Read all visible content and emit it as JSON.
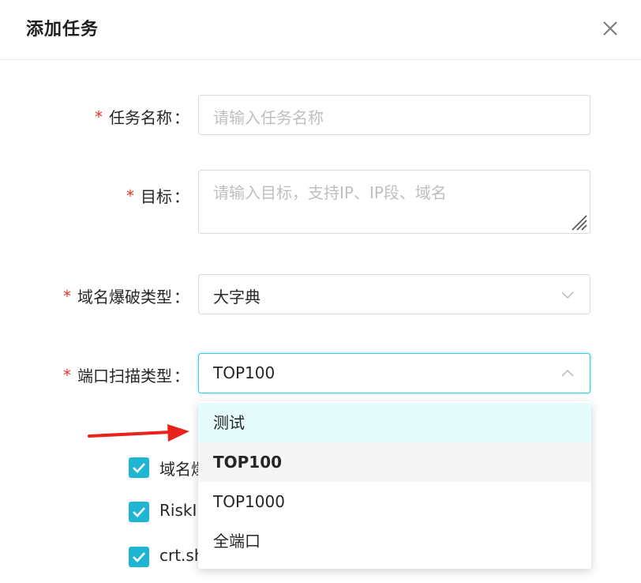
{
  "dialog": {
    "title": "添加任务",
    "close_icon": "close-icon"
  },
  "form": {
    "task_name": {
      "label": "任务名称",
      "placeholder": "请输入任务名称"
    },
    "target": {
      "label": "目标",
      "placeholder": "请输入目标，支持IP、IP段、域名"
    },
    "domain_brute_type": {
      "label": "域名爆破类型",
      "value": "大字典"
    },
    "port_scan_type": {
      "label": "端口扫描类型",
      "value": "TOP100",
      "options": [
        "测试",
        "TOP100",
        "TOP1000",
        "全端口"
      ]
    },
    "checkboxes": [
      {
        "label": "域名爆",
        "checked": true
      },
      {
        "label": "RiskI",
        "checked": true
      },
      {
        "label": "crt.sh",
        "checked": true
      }
    ]
  },
  "annotation": {
    "arrow_color": "#e8231c"
  },
  "colors": {
    "required": "#e8342c",
    "accent": "#1fb6d4",
    "focus_border": "#3ec9d6",
    "hover_bg": "#e6fbfb"
  }
}
